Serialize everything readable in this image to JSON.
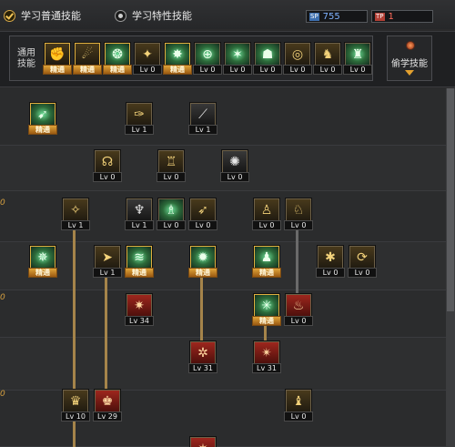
{
  "header": {
    "tab_normal": "学习普通技能",
    "tab_trait": "学习特性技能",
    "sp_tag": "SP",
    "sp_value": "755",
    "tp_tag": "TP",
    "tp_value": "1"
  },
  "common": {
    "label": "通用技能",
    "skills": [
      {
        "icon": "martial-icon",
        "glyph": "✊",
        "level": "精通",
        "type": "gold",
        "master": true
      },
      {
        "icon": "crouch-icon",
        "glyph": "☄",
        "level": "精通",
        "type": "gold",
        "master": true
      },
      {
        "icon": "leap-icon",
        "glyph": "❂",
        "level": "精通",
        "type": "green",
        "master": true
      },
      {
        "icon": "wings-icon",
        "glyph": "✦",
        "level": "Lv 0",
        "type": "gold",
        "master": false
      },
      {
        "icon": "burst-icon",
        "glyph": "✸",
        "level": "精通",
        "type": "green",
        "master": true
      },
      {
        "icon": "target-icon",
        "glyph": "⊕",
        "level": "Lv 0",
        "type": "green",
        "master": false
      },
      {
        "icon": "strike-icon",
        "glyph": "✶",
        "level": "Lv 0",
        "type": "green",
        "master": false
      },
      {
        "icon": "crouch-fighter-icon",
        "glyph": "☗",
        "level": "Lv 0",
        "type": "green",
        "master": false
      },
      {
        "icon": "swirl-icon",
        "glyph": "◎",
        "level": "Lv 0",
        "type": "gold",
        "master": false
      },
      {
        "icon": "muscle-icon",
        "glyph": "♞",
        "level": "Lv 0",
        "type": "gold",
        "master": false
      },
      {
        "icon": "slam-icon",
        "glyph": "♜",
        "level": "Lv 0",
        "type": "green",
        "master": false
      }
    ],
    "steal_label": "偷学技能"
  },
  "tree": {
    "row_numbers": [
      "0",
      "0",
      "0"
    ],
    "skills": [
      {
        "icon": "dash-icon",
        "glyph": "➹",
        "level": "精通",
        "type": "green",
        "master": true
      },
      {
        "icon": "kick-icon",
        "glyph": "✑",
        "level": "Lv 1",
        "type": "gold",
        "master": false
      },
      {
        "icon": "throw-icon",
        "glyph": "⟋",
        "level": "Lv 1",
        "type": "dark",
        "master": false
      },
      {
        "icon": "spin-icon",
        "glyph": "☊",
        "level": "Lv 0",
        "type": "gold",
        "master": false
      },
      {
        "icon": "stance-icon",
        "glyph": "♖",
        "level": "Lv 0",
        "type": "gold",
        "master": false
      },
      {
        "icon": "shock-icon",
        "glyph": "✺",
        "level": "Lv 0",
        "type": "dark",
        "master": false
      },
      {
        "icon": "spark-icon",
        "glyph": "✧",
        "level": "Lv 1",
        "type": "gold",
        "master": false
      },
      {
        "icon": "whirl-icon",
        "glyph": "♆",
        "level": "Lv 1",
        "type": "dark",
        "master": false
      },
      {
        "icon": "body-icon",
        "glyph": "♗",
        "level": "Lv 0",
        "type": "green",
        "master": false
      },
      {
        "icon": "run-icon",
        "glyph": "➶",
        "level": "Lv 0",
        "type": "gold",
        "master": false
      },
      {
        "icon": "squat-icon",
        "glyph": "♙",
        "level": "Lv 0",
        "type": "gold",
        "master": false
      },
      {
        "icon": "guard-icon",
        "glyph": "♘",
        "level": "Lv 0",
        "type": "gold",
        "master": false
      },
      {
        "icon": "lightning-icon",
        "glyph": "✵",
        "level": "精通",
        "type": "green",
        "master": true
      },
      {
        "icon": "punch-icon",
        "glyph": "➤",
        "level": "Lv 1",
        "type": "gold",
        "master": false
      },
      {
        "icon": "wave-icon",
        "glyph": "≋",
        "level": "精通",
        "type": "green",
        "master": true
      },
      {
        "icon": "nova-icon",
        "glyph": "✹",
        "level": "精通",
        "type": "green",
        "master": true
      },
      {
        "icon": "fighter-icon",
        "glyph": "♟",
        "level": "精通",
        "type": "green",
        "master": true
      },
      {
        "icon": "fire-fist-icon",
        "glyph": "✱",
        "level": "Lv 0",
        "type": "gold",
        "master": false
      },
      {
        "icon": "ring-icon",
        "glyph": "⟳",
        "level": "Lv 0",
        "type": "gold",
        "master": false
      },
      {
        "icon": "blaze-icon",
        "glyph": "✷",
        "level": "Lv 34",
        "type": "red",
        "master": false
      },
      {
        "icon": "storm-icon",
        "glyph": "✳",
        "level": "精通",
        "type": "green",
        "master": true
      },
      {
        "icon": "rage-icon",
        "glyph": "♨",
        "level": "Lv 0",
        "type": "red",
        "master": false
      },
      {
        "icon": "explode-icon",
        "glyph": "✲",
        "level": "Lv 31",
        "type": "red",
        "master": false
      },
      {
        "icon": "crush-icon",
        "glyph": "✴",
        "level": "Lv 31",
        "type": "red",
        "master": false
      },
      {
        "icon": "fist-icon",
        "glyph": "♛",
        "level": "Lv 10",
        "type": "gold",
        "master": false
      },
      {
        "icon": "brawl-icon",
        "glyph": "♚",
        "level": "Lv 29",
        "type": "red",
        "master": false
      },
      {
        "icon": "sweep-icon",
        "glyph": "♝",
        "level": "Lv 0",
        "type": "gold",
        "master": false
      },
      {
        "icon": "partial-icon",
        "glyph": "✶",
        "level": "",
        "type": "red",
        "master": false
      }
    ]
  }
}
